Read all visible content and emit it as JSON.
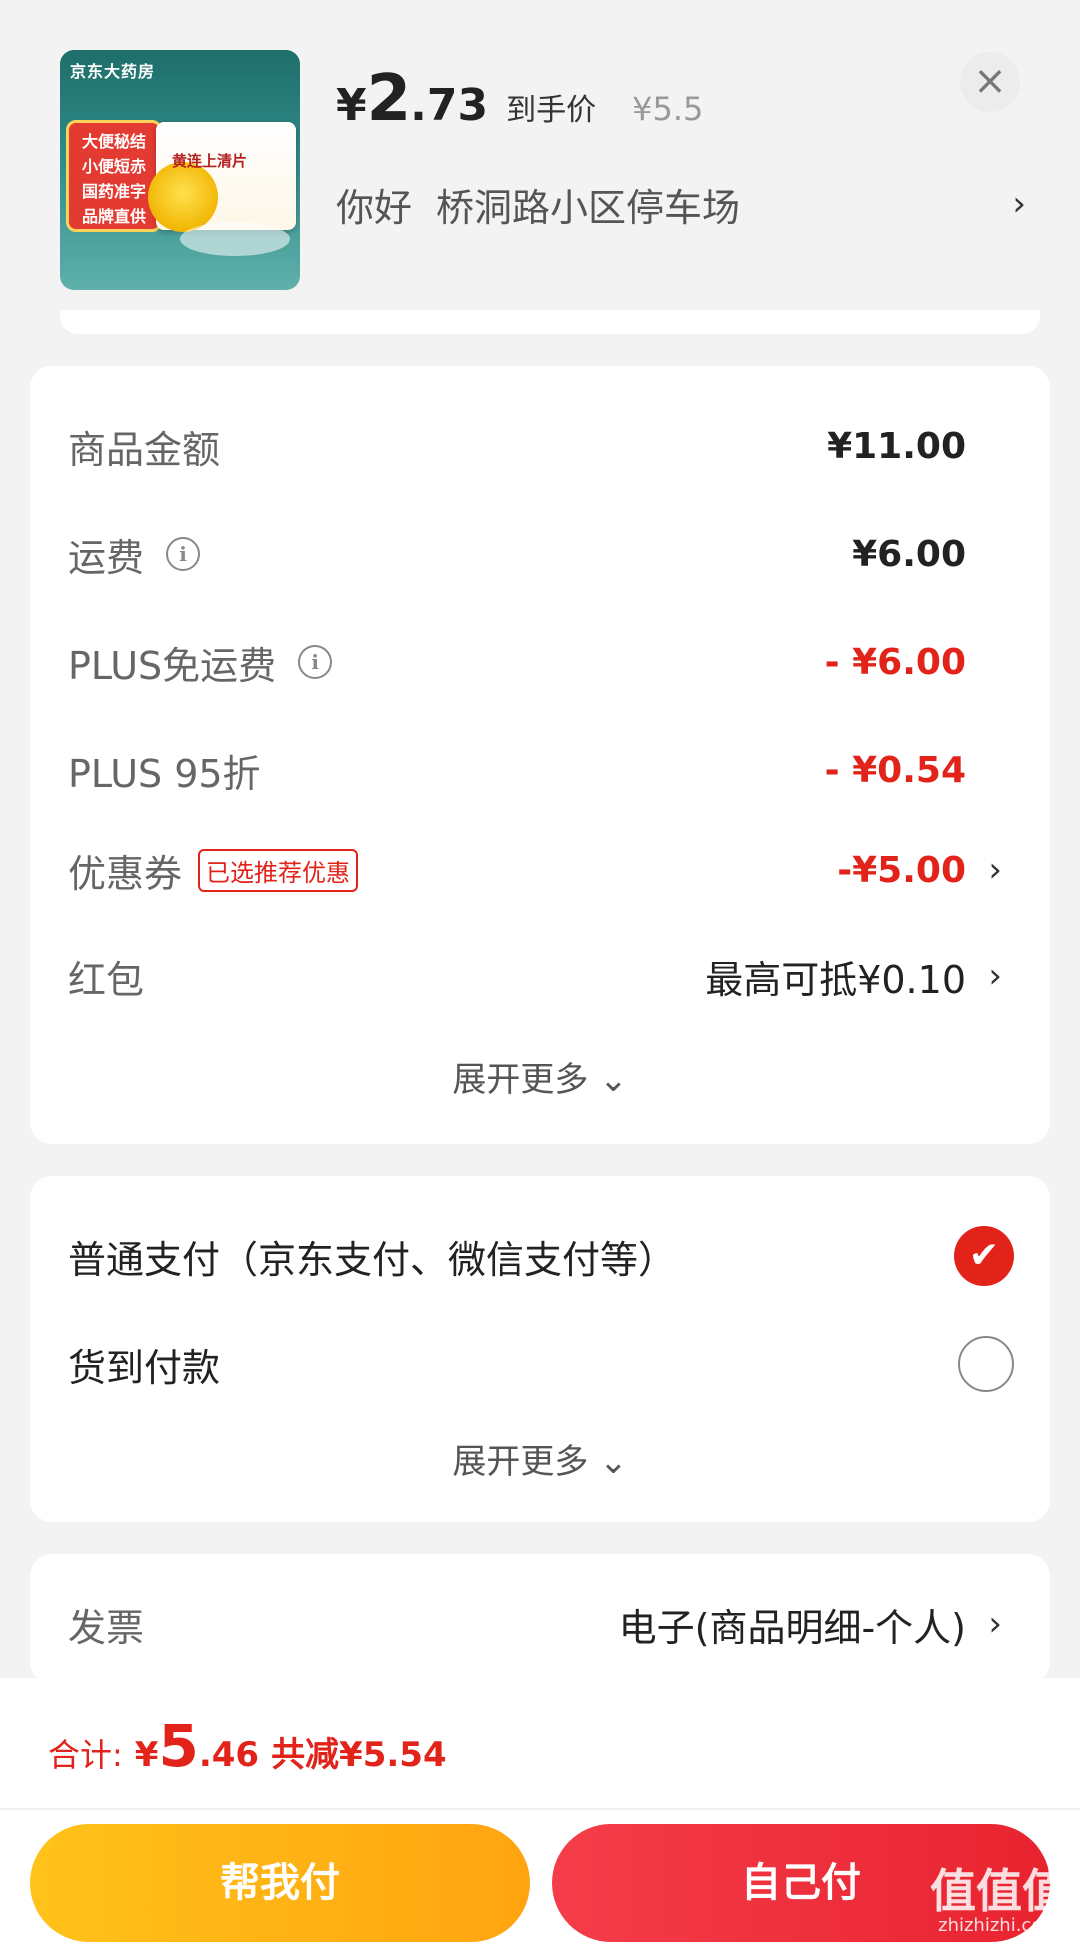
{
  "product": {
    "brand": "京东大药房",
    "badge_lines": [
      "大便秘结",
      "小便短赤",
      "国药准字",
      "品牌直供"
    ],
    "box_name": "黄连上清片"
  },
  "header": {
    "yen": "¥",
    "price_int": "2",
    "price_dec": ".73",
    "price_tag": "到手价",
    "orig_price": "¥5.5",
    "close": "×",
    "address_label": "你好",
    "address_value": "桥洞路小区停车场",
    "address_arrow": "›"
  },
  "summary": {
    "rows": [
      {
        "label": "商品金额",
        "value": "¥11.00"
      },
      {
        "label": "运费",
        "value": "¥6.00"
      },
      {
        "label": "PLUS免运费",
        "value": "- ¥6.00"
      },
      {
        "label": "PLUS 95折",
        "value": "- ¥0.54"
      },
      {
        "label": "优惠券",
        "badge": "已选推荐优惠",
        "value": "-¥5.00",
        "arrow": "›"
      },
      {
        "label": "红包",
        "value": "最高可抵¥0.10",
        "arrow": "›"
      }
    ],
    "expand": "展开更多 ⌄",
    "info_icon": "i"
  },
  "payment": {
    "options": [
      {
        "label": "普通支付（京东支付、微信支付等）",
        "selected": true
      },
      {
        "label": "货到付款",
        "selected": false
      }
    ],
    "check": "✔",
    "expand": "展开更多 ⌄"
  },
  "invoice": {
    "label": "发票",
    "value": "电子(商品明细-个人)",
    "arrow": "›"
  },
  "footer": {
    "total_label": "合计:",
    "yen": "¥",
    "total_int": "5",
    "total_dec": ".46",
    "saved": "共减¥5.54",
    "help_pay": "帮我付",
    "self_pay": "自己付"
  },
  "watermark": {
    "main": "值值值",
    "sub": "zhizhizhi.com"
  },
  "colors": {
    "accent_red": "#e2231a",
    "pay_yellow": "#ffb514",
    "pay_red": "#f0303c"
  }
}
